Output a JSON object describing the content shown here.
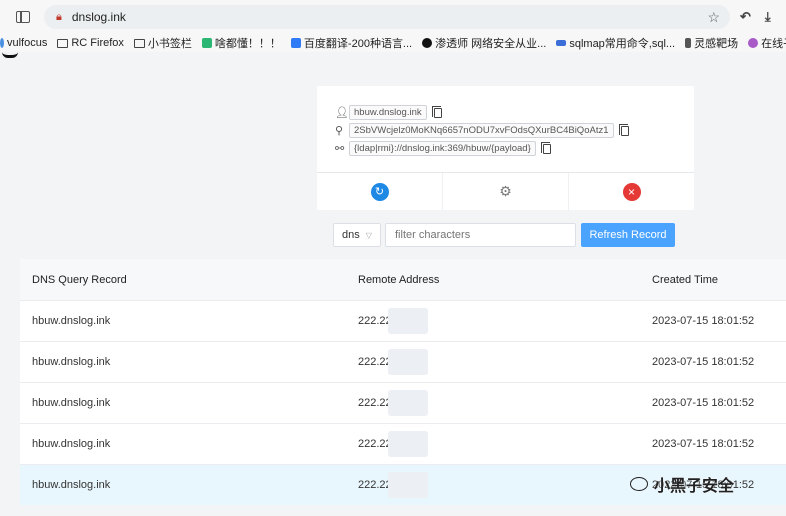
{
  "browser": {
    "url": "dnslog.ink",
    "bookmarks": [
      {
        "label": "vulfocus",
        "icon": "vulfocus-icon",
        "color": "#4a90e2"
      },
      {
        "label": "RC Firefox",
        "icon": "folder-icon",
        "color": ""
      },
      {
        "label": "小书签栏",
        "icon": "folder-icon",
        "color": ""
      },
      {
        "label": "啥都懂！！！",
        "icon": "site-icon",
        "color": "#2bb673"
      },
      {
        "label": "百度翻译-200种语言...",
        "icon": "translate-icon",
        "color": "#2f7bf6"
      },
      {
        "label": "渗透师 网络安全从业...",
        "icon": "shield-icon",
        "color": "#111111"
      },
      {
        "label": "sqlmap常用命令,sql...",
        "icon": "site-icon",
        "color": "#3c6ed8"
      },
      {
        "label": "灵感靶场",
        "icon": "bookmark-icon",
        "color": "#555555"
      },
      {
        "label": "在线子域",
        "icon": "face-icon",
        "color": "#a85ac7"
      }
    ]
  },
  "card": {
    "domain": "hbuw.dnslog.ink",
    "token": "2SbVWcjelz0MoKNq6657nODU7xvFOdsQXurBC4BiQoAtz1",
    "payload": "{ldap|rmi}://dnslog.ink:369/hbuw/{payload}"
  },
  "controls": {
    "type_select": "dns",
    "filter_placeholder": "filter characters",
    "refresh_label": "Refresh Record"
  },
  "table": {
    "headers": [
      "DNS Query Record",
      "Remote Address",
      "Created Time"
    ],
    "rows": [
      {
        "query": "hbuw.dnslog.ink",
        "address": "222.22",
        "time": "2023-07-15 18:01:52"
      },
      {
        "query": "hbuw.dnslog.ink",
        "address": "222.22",
        "time": "2023-07-15 18:01:52"
      },
      {
        "query": "hbuw.dnslog.ink",
        "address": "222.22",
        "time": "2023-07-15 18:01:52"
      },
      {
        "query": "hbuw.dnslog.ink",
        "address": "222.22",
        "time": "2023-07-15 18:01:52"
      },
      {
        "query": "hbuw.dnslog.ink",
        "address": "222.22",
        "time": "2023-07-15 18:01:52"
      }
    ]
  },
  "watermark": "小黑子安全",
  "colors": {
    "accent": "#4aa3ff",
    "danger": "#e53935",
    "highlight_row": "#e8f6fd"
  }
}
